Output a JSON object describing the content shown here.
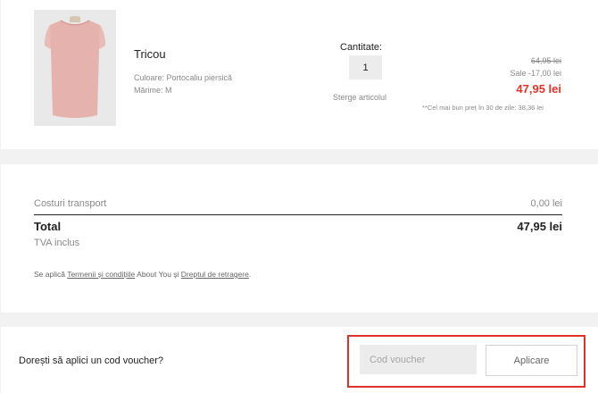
{
  "product": {
    "name": "Tricou",
    "color_line": "Culoare: Portocaliu piersică",
    "size_line": "Mărime: M",
    "quantity_label": "Cantitate:",
    "quantity_value": "1",
    "remove_label": "Sterge articolul",
    "price_original": "64,95 lei",
    "price_discount": "Sale -17,00 lei",
    "price_final": "47,95 lei",
    "best_price_note": "**Cel mai bun preț în 30 de zile: 38,36 lei",
    "image_icon": "t-shirt-photo",
    "colors": {
      "sale_red": "#e6332a",
      "shirt": "#e6b2ad"
    }
  },
  "summary": {
    "shipping_label": "Costuri transport",
    "shipping_value": "0,00 lei",
    "total_label": "Total",
    "total_value": "47,95 lei",
    "vat_label": "TVA inclus",
    "terms_prefix": "Se aplică",
    "terms_link": "Termenii și condițiile",
    "terms_middle": "About You și",
    "withdrawal_link": "Dreptul de retragere",
    "terms_suffix": "."
  },
  "voucher": {
    "question": "Dorești să aplici un cod voucher?",
    "input_placeholder": "Cod voucher",
    "input_value": "",
    "apply_label": "Aplicare",
    "highlight_color": "#e0322b"
  }
}
